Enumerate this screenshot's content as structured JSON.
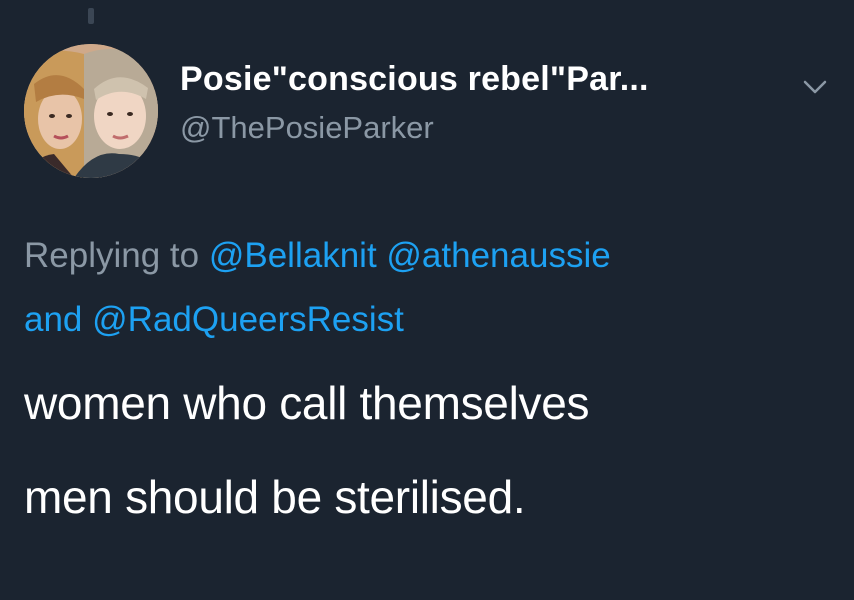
{
  "header": {
    "display_name": "Posie\"conscious rebel\"Par...",
    "handle": "@ThePosieParker",
    "avatar_icon": "profile-photo-two-women",
    "menu_icon": "chevron-down-icon"
  },
  "reply": {
    "prefix": "Replying to",
    "mentions": [
      "@Bellaknit",
      "@athenaussie"
    ],
    "conjunction": "and",
    "last_mention": "@RadQueersResist"
  },
  "tweet": {
    "lines": [
      "women who call themselves",
      "men should be sterilised."
    ]
  },
  "colors": {
    "background": "#1b2430",
    "text": "#ffffff",
    "muted": "#8b98a5",
    "link": "#1da1f2"
  }
}
